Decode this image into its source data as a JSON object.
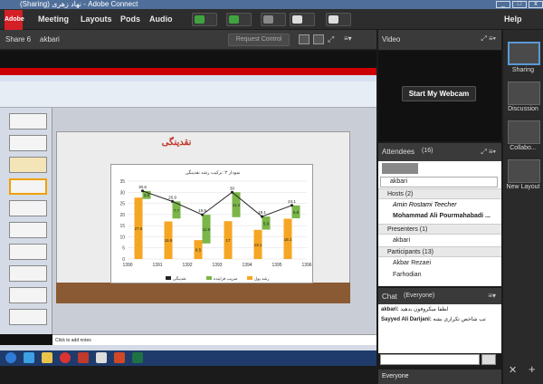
{
  "window": {
    "title": "(Sharing) نهاد زهری - Adobe Connect"
  },
  "menu": [
    "Meeting",
    "Layouts",
    "Pods",
    "Audio"
  ],
  "help": "Help",
  "share": {
    "title": "Share 6",
    "user": "akbari",
    "request_control": "Request Control"
  },
  "slide": {
    "title": "نقدینگی",
    "chart_title": "نمودار ۴: ترکیب رشد نقدینگی"
  },
  "chart_data": {
    "type": "bar",
    "categories": [
      "1390",
      "1391",
      "1392",
      "1393",
      "1394",
      "1395",
      "1396"
    ],
    "series": [
      {
        "name": "رشد پول",
        "values": [
          27.6,
          16.9,
          8.5,
          17.0,
          13.1,
          18.1
        ]
      },
      {
        "name": "ضریب فزاینده",
        "values": [
          3.6,
          7.7,
          12.9,
          11.2,
          5.9,
          5.8
        ]
      },
      {
        "name": "نقدینگی",
        "values": [
          30.6,
          25.9,
          19.9,
          30.0,
          19.1,
          24.1
        ]
      }
    ],
    "ylim": [
      0,
      35
    ]
  },
  "notes": "Click to add notes",
  "video": {
    "title": "Video",
    "button": "Start My Webcam"
  },
  "attendees": {
    "title": "Attendees",
    "count": "(16)",
    "search": "akbari",
    "hosts_label": "Hosts (2)",
    "hosts": [
      "Amin Rostami Teecher",
      "Mohammad Ali Pourmahabadi ..."
    ],
    "presenters_label": "Presenters (1)",
    "presenters": [
      "akbari"
    ],
    "participants_label": "Participants (13)",
    "participants": [
      "Akbar Rezaei",
      "Farhodian"
    ]
  },
  "chat": {
    "title": "Chat",
    "scope": "(Everyone)",
    "messages": [
      {
        "from": "akbari:",
        "text": "لطفا میکروفون بدهید"
      },
      {
        "from": "Sayyed Ali Darijani:",
        "text": "تب شاخص تکراری بشه"
      }
    ],
    "footer": "Everyone"
  },
  "layouts": [
    "Sharing",
    "Discussion",
    "Collabo...",
    "New Layout"
  ],
  "colors": {
    "bar_orange": "#f5a623",
    "bar_green": "#7ab648",
    "accent": "#4f6f9a"
  }
}
